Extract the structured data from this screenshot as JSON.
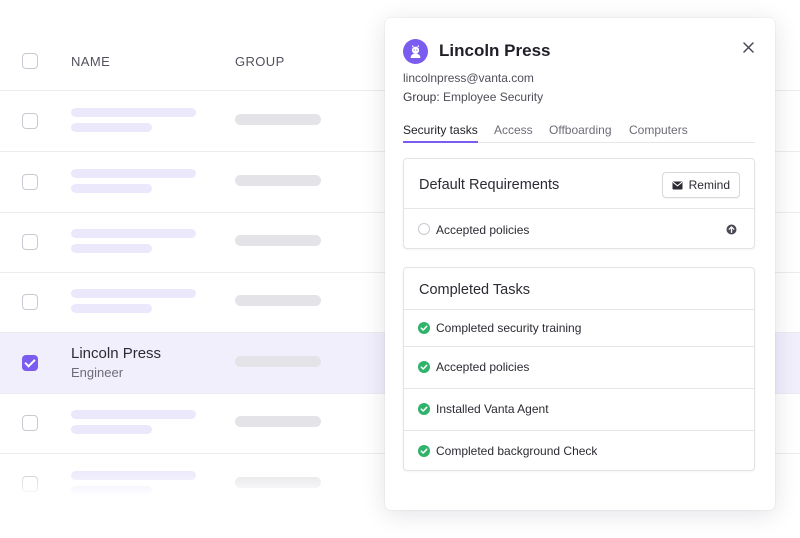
{
  "table": {
    "columns": [
      "NAME",
      "GROUP"
    ],
    "selected_row": {
      "name": "Lincoln Press",
      "role": "Engineer"
    }
  },
  "panel": {
    "title": "Lincoln Press",
    "email": "lincolnpress@vanta.com",
    "group_label": "Group:",
    "group_value": "Employee Security",
    "tabs": [
      "Security tasks",
      "Access",
      "Offboarding",
      "Computers"
    ],
    "active_tab": "Security tasks",
    "default_requirements": {
      "title": "Default Requirements",
      "remind_label": "Remind",
      "items": [
        "Accepted policies"
      ]
    },
    "completed_tasks": {
      "title": "Completed Tasks",
      "items": [
        "Completed security training",
        "Accepted policies",
        "Installed Vanta Agent",
        "Completed background Check"
      ]
    }
  },
  "icons": [
    "user-avatar-icon",
    "close-icon",
    "mail-icon",
    "upload-arrow-icon",
    "check-circle-icon"
  ],
  "colors": {
    "accent": "#7b5cf0",
    "success": "#2fb36b",
    "selected_row": "#f2effd"
  }
}
